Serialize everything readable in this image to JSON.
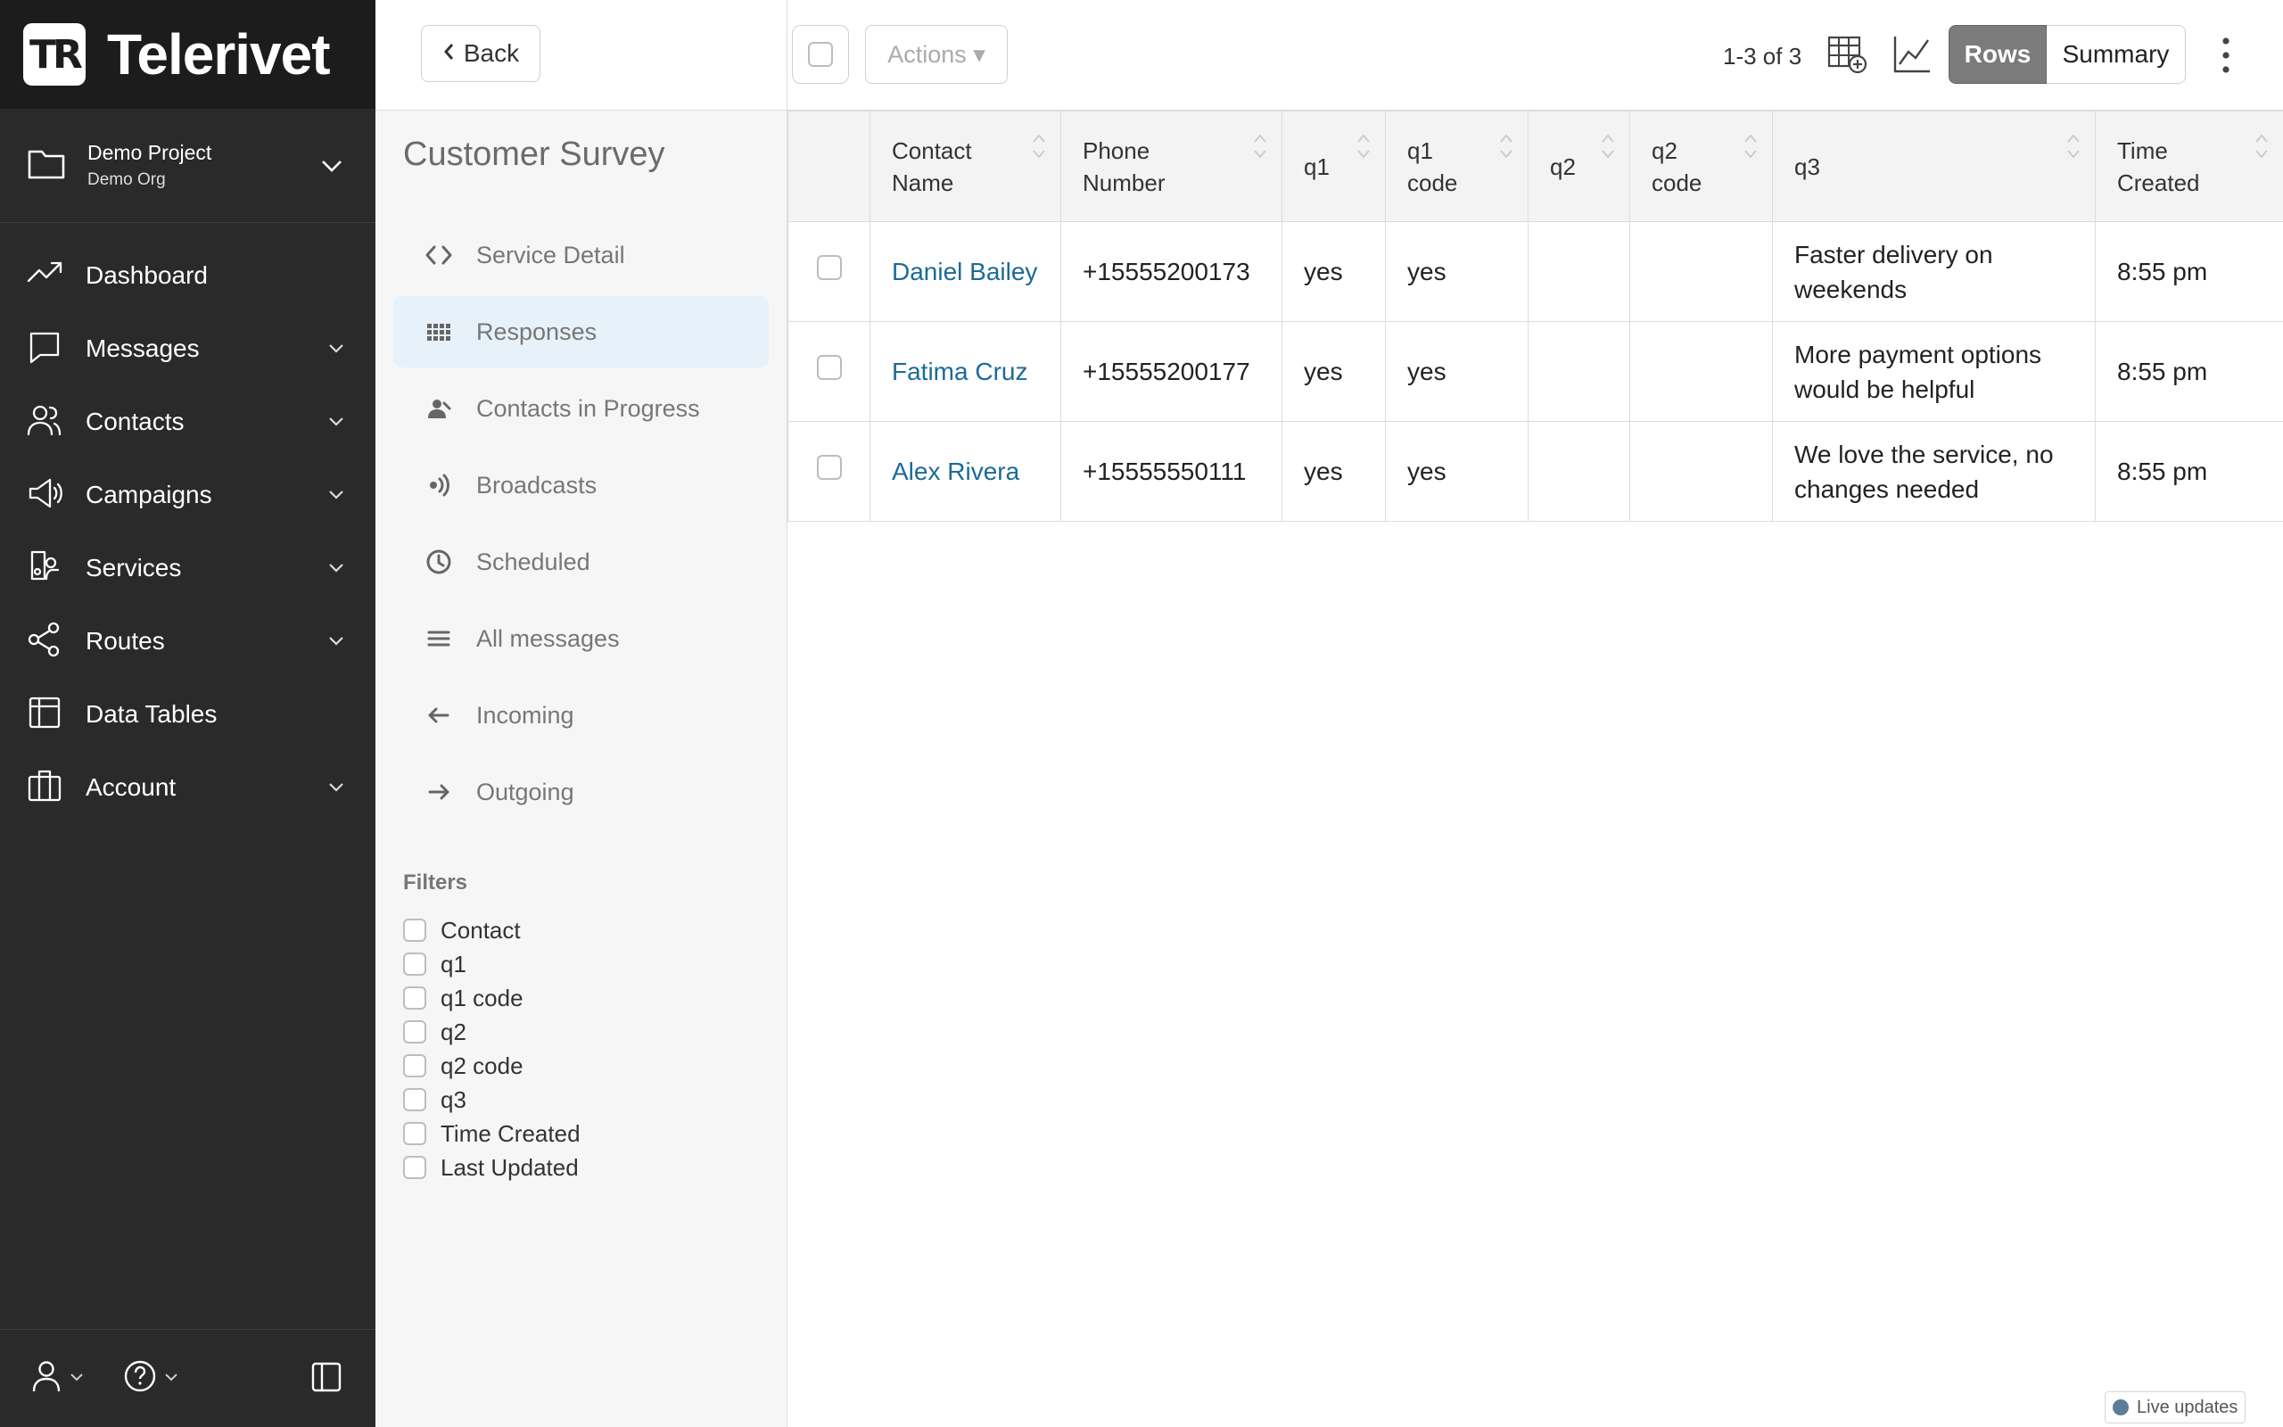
{
  "brand": {
    "name": "Telerivet",
    "mark": "TR"
  },
  "project": {
    "name": "Demo Project",
    "org": "Demo Org"
  },
  "nav": [
    {
      "label": "Dashboard",
      "icon": "trending-up-icon",
      "expandable": false
    },
    {
      "label": "Messages",
      "icon": "chat-bubble-icon",
      "expandable": true
    },
    {
      "label": "Contacts",
      "icon": "users-icon",
      "expandable": true
    },
    {
      "label": "Campaigns",
      "icon": "megaphone-icon",
      "expandable": true
    },
    {
      "label": "Services",
      "icon": "robot-icon",
      "expandable": true
    },
    {
      "label": "Routes",
      "icon": "share-icon",
      "expandable": true
    },
    {
      "label": "Data Tables",
      "icon": "table-icon",
      "expandable": false
    },
    {
      "label": "Account",
      "icon": "briefcase-icon",
      "expandable": true
    }
  ],
  "back_label": "Back",
  "survey_title": "Customer Survey",
  "subnav": [
    {
      "label": "Service Detail",
      "icon": "code-icon",
      "active": false
    },
    {
      "label": "Responses",
      "icon": "grid-icon",
      "active": true
    },
    {
      "label": "Contacts in Progress",
      "icon": "user-progress-icon",
      "active": false
    },
    {
      "label": "Broadcasts",
      "icon": "broadcast-icon",
      "active": false
    },
    {
      "label": "Scheduled",
      "icon": "clock-icon",
      "active": false
    },
    {
      "label": "All messages",
      "icon": "list-icon",
      "active": false
    },
    {
      "label": "Incoming",
      "icon": "arrow-left-icon",
      "active": false
    },
    {
      "label": "Outgoing",
      "icon": "arrow-right-icon",
      "active": false
    }
  ],
  "filters": {
    "title": "Filters",
    "items": [
      "Contact",
      "q1",
      "q1 code",
      "q2",
      "q2 code",
      "q3",
      "Time Created",
      "Last Updated"
    ]
  },
  "toolbar": {
    "actions_label": "Actions ▾",
    "count": "1-3 of 3",
    "rows_label": "Rows",
    "summary_label": "Summary"
  },
  "table": {
    "headers": [
      "Contact Name",
      "Phone Number",
      "q1",
      "q1 code",
      "q2",
      "q2 code",
      "q3",
      "Time Created"
    ],
    "rows": [
      {
        "name": "Daniel Bailey",
        "phone": "+15555200173",
        "q1": "yes",
        "q1_code": "yes",
        "q2": "",
        "q2_code": "",
        "q3": "Faster delivery on weekends",
        "time": "8:55 pm"
      },
      {
        "name": "Fatima Cruz",
        "phone": "+15555200177",
        "q1": "yes",
        "q1_code": "yes",
        "q2": "",
        "q2_code": "",
        "q3": "More payment options would be helpful",
        "time": "8:55 pm"
      },
      {
        "name": "Alex Rivera",
        "phone": "+15555550111",
        "q1": "yes",
        "q1_code": "yes",
        "q2": "",
        "q2_code": "",
        "q3": "We love the service, no changes needed",
        "time": "8:55 pm"
      }
    ]
  },
  "live_updates": "Live updates",
  "colors": {
    "nav_bg": "#2a2a2a",
    "link": "#1b6a99",
    "active_sub": "#e6f1f9",
    "rows_btn": "#7b7b7b"
  }
}
